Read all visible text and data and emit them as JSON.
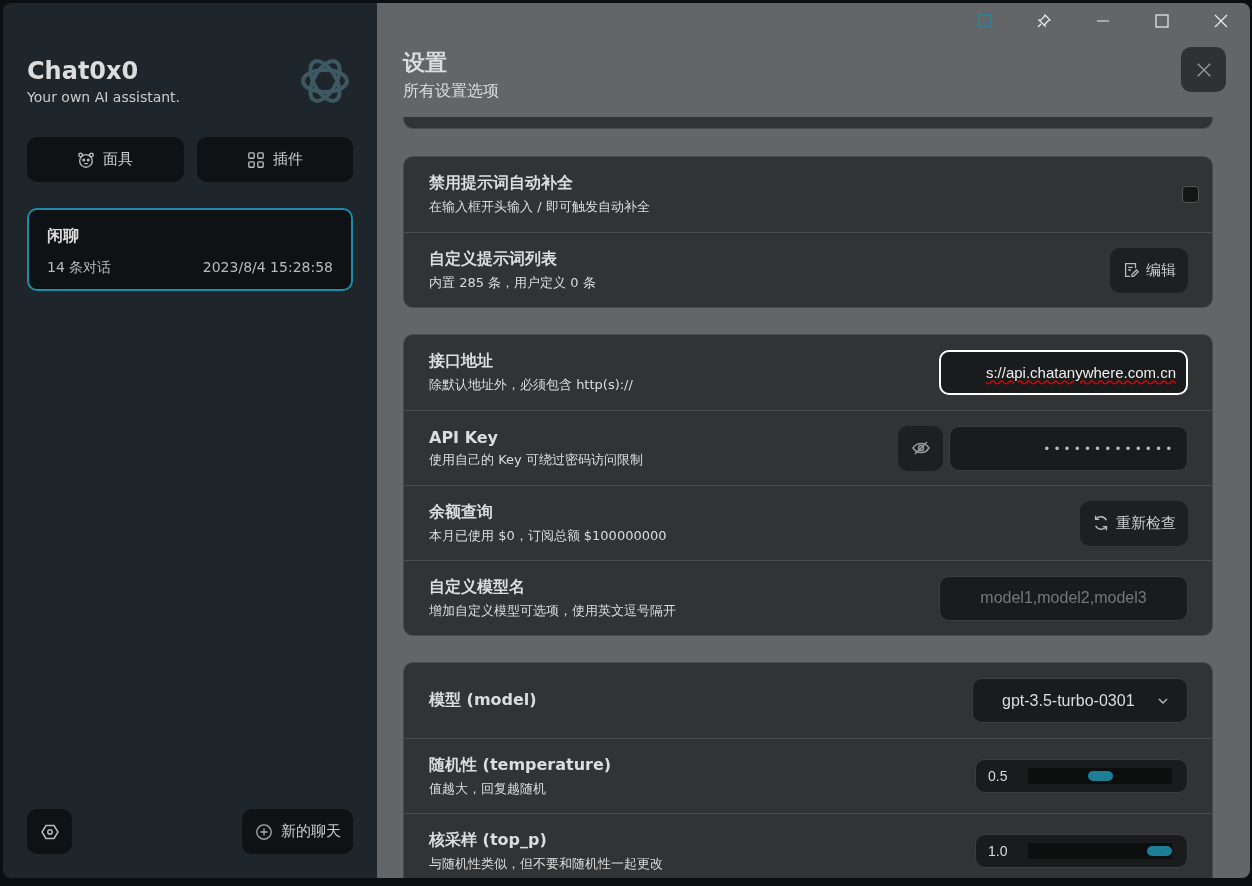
{
  "sidebar": {
    "title": "Chat0x0",
    "subtitle": "Your own AI assistant.",
    "buttons": [
      {
        "kind": "mask",
        "label": "面具"
      },
      {
        "kind": "plugin",
        "label": "插件"
      }
    ],
    "chats": [
      {
        "title": "闲聊",
        "count": "14 条对话",
        "time": "2023/8/4 15:28:58",
        "selected": true
      }
    ],
    "new_chat": "新的聊天"
  },
  "settings": {
    "title": "设置",
    "subtitle": "所有设置选项",
    "groups": [
      {
        "rows": [
          {
            "kind": "checkbox",
            "title": "禁用提示词自动补全",
            "desc": "在输入框开头输入 / 即可触发自动补全",
            "checked": false
          },
          {
            "kind": "edit_button",
            "title": "自定义提示词列表",
            "desc": "内置 285 条，用户定义 0 条",
            "button": "编辑"
          }
        ]
      },
      {
        "rows": [
          {
            "kind": "input",
            "title": "接口地址",
            "desc": "除默认地址外，必须包含 http(s)://",
            "value": "s://api.chatanywhere.com.cn",
            "focused": true
          },
          {
            "kind": "password",
            "title": "API Key",
            "desc": "使用自己的 Key 可绕过密码访问限制",
            "value": "• • • • • • • • • • • • •"
          },
          {
            "kind": "refresh_button",
            "title": "余额查询",
            "desc": "本月已使用 $0，订阅总额 $100000000",
            "button": "重新检查"
          },
          {
            "kind": "input",
            "title": "自定义模型名",
            "desc": "增加自定义模型可选项，使用英文逗号隔开",
            "placeholder": "model1,model2,model3",
            "focused": false
          }
        ]
      },
      {
        "rows": [
          {
            "kind": "select",
            "title": "模型 (model)",
            "value": "gpt-3.5-turbo-0301"
          },
          {
            "kind": "slider",
            "title": "随机性 (temperature)",
            "desc": "值越大，回复越随机",
            "reading": "0.5",
            "level": 0.5
          },
          {
            "kind": "slider",
            "title": "核采样 (top_p)",
            "desc": "与随机性类似，但不要和随机性一起更改",
            "reading": "1.0",
            "level": 1.0
          }
        ]
      }
    ]
  }
}
